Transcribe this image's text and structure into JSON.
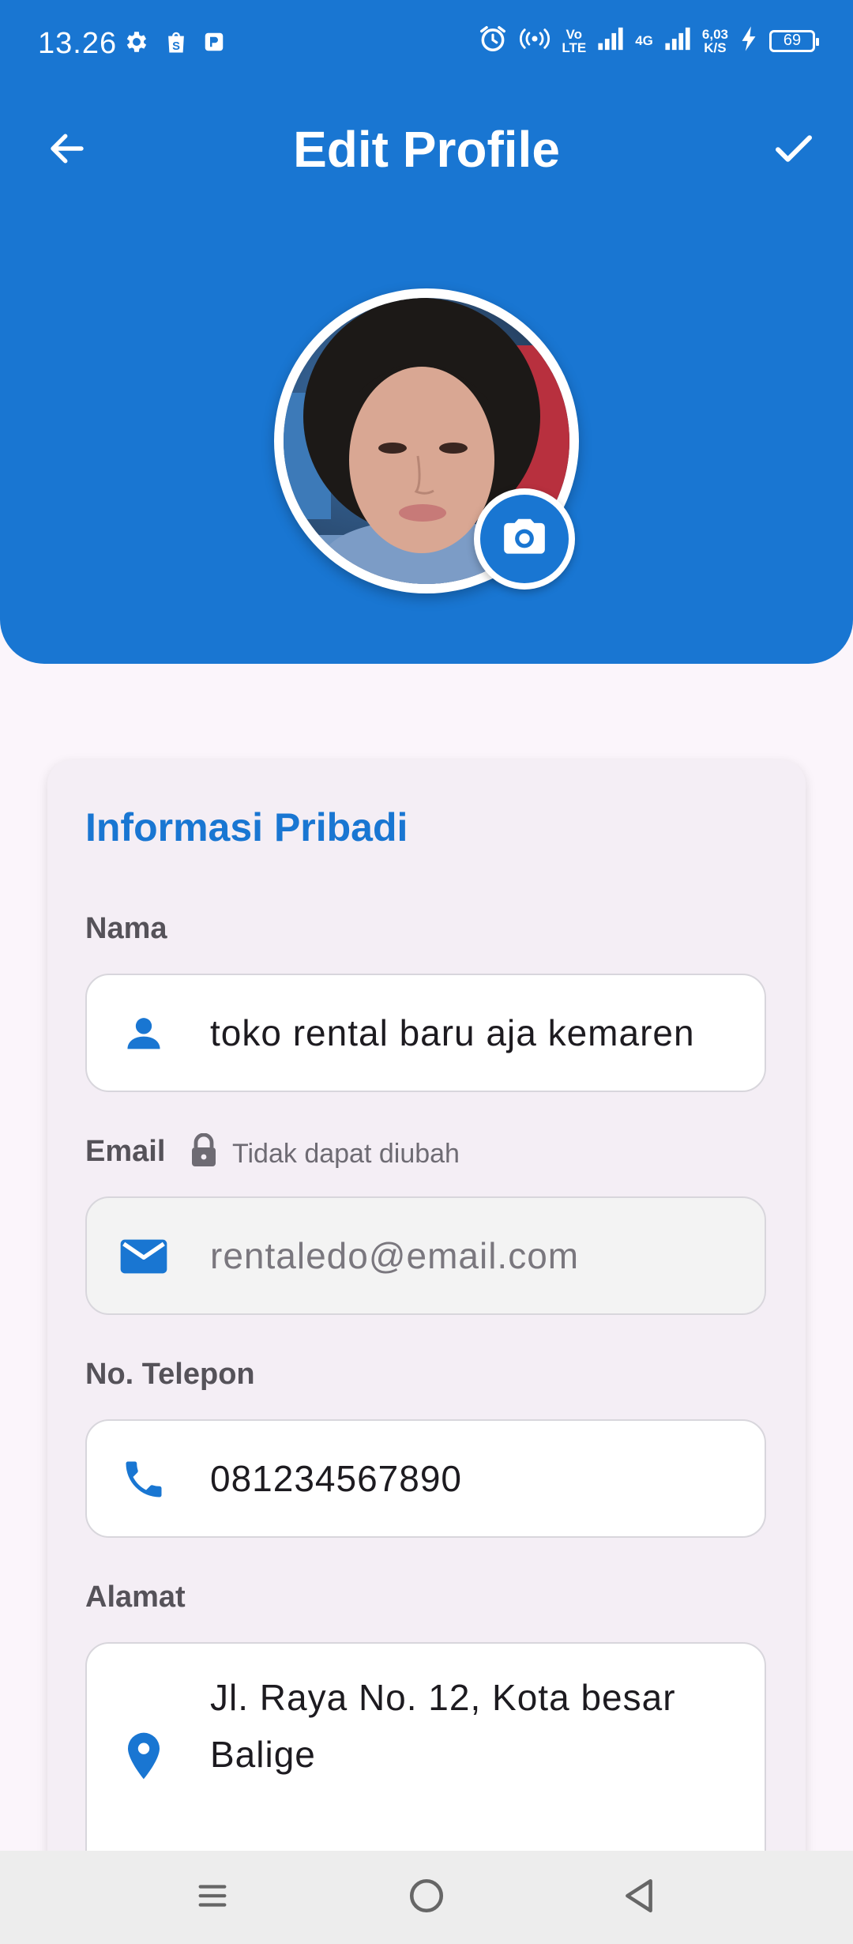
{
  "status_bar": {
    "time": "13.26",
    "volte_top": "Vo",
    "volte_bottom": "LTE",
    "network_type": "4G",
    "net_speed_value": "6,03",
    "net_speed_unit": "K/S",
    "battery_level": "69"
  },
  "app_bar": {
    "title": "Edit Profile"
  },
  "section": {
    "title": "Informasi Pribadi"
  },
  "fields": {
    "name": {
      "label": "Nama",
      "value": "toko rental baru aja kemaren"
    },
    "email": {
      "label": "Email",
      "note": "Tidak dapat diubah",
      "value": "rentaledo@email.com"
    },
    "phone": {
      "label": "No. Telepon",
      "value": "081234567890"
    },
    "address": {
      "label": "Alamat",
      "value": "Jl. Raya No. 12, Kota besar Balige"
    }
  },
  "colors": {
    "primary": "#1976d2",
    "background": "#fbf5fb",
    "card": "#f4eef5",
    "nav_bar": "#ededed"
  },
  "icons": {
    "back": "arrow-left-icon",
    "save": "check-icon",
    "camera": "camera-icon",
    "name": "person-icon",
    "email": "mail-icon",
    "lock": "lock-icon",
    "phone": "phone-icon",
    "address": "location-pin-icon"
  }
}
